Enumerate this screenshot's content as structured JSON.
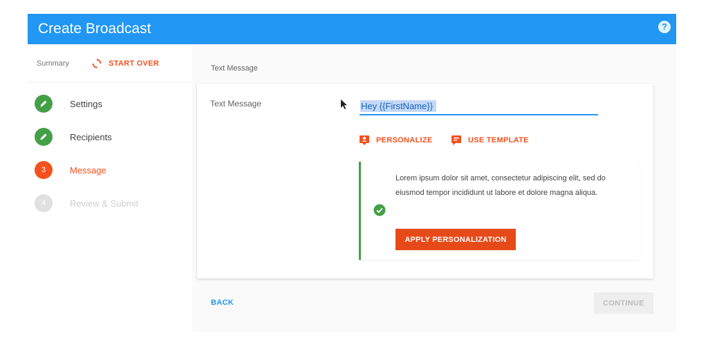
{
  "header": {
    "title": "Create Broadcast",
    "help_icon": "question-mark-icon",
    "help_glyph": "?"
  },
  "sidebar": {
    "summary_label": "Summary",
    "start_over_label": "START OVER",
    "steps": [
      {
        "label": "Settings",
        "state": "done",
        "icon": "pencil-icon"
      },
      {
        "label": "Recipients",
        "state": "done",
        "icon": "pencil-icon"
      },
      {
        "label": "Message",
        "state": "active",
        "number": "3"
      },
      {
        "label": "Review & Submit",
        "state": "pending",
        "number": "4"
      }
    ]
  },
  "main": {
    "section_title": "Text Message",
    "field_label": "Text Message",
    "message_value": "Hey {{FirstName}}",
    "personalize_label": "PERSONALIZE",
    "use_template_label": "USE TEMPLATE",
    "suggestion_text": "Lorem ipsum dolor sit amet, consectetur adipiscing elit, sed do eiusmod tempor incididunt ut labore et dolore magna aliqua.",
    "apply_label": "APPLY PERSONALIZATION"
  },
  "footer": {
    "back_label": "BACK",
    "continue_label": "CONTINUE"
  },
  "colors": {
    "primary": "#2196f3",
    "accent": "#f4511e",
    "success": "#43a047"
  }
}
